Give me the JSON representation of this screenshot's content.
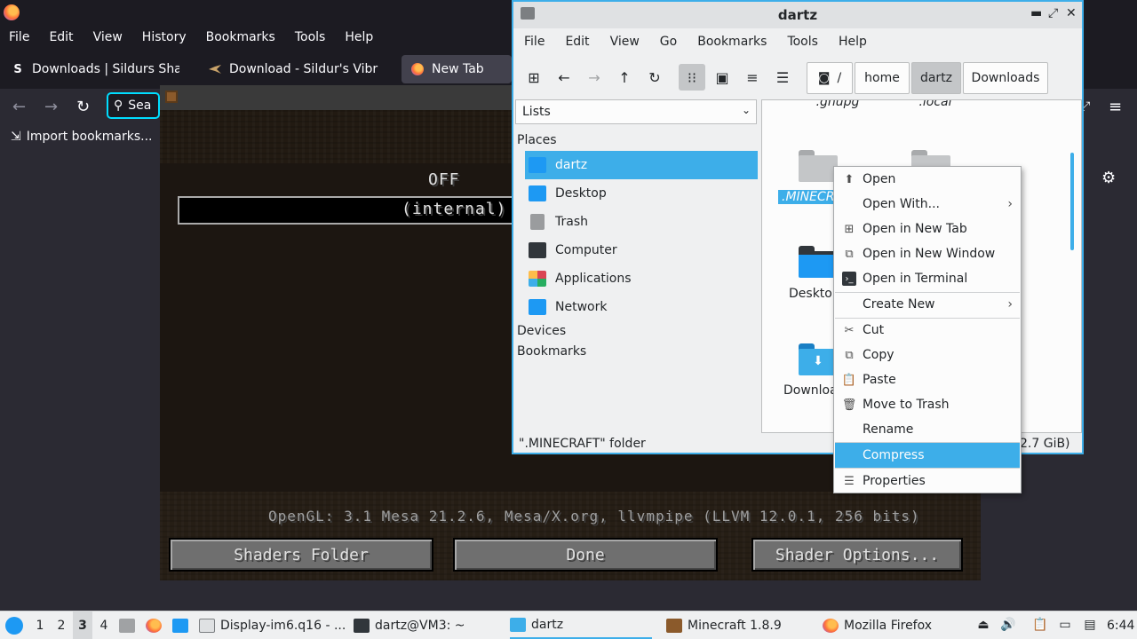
{
  "firefox": {
    "menu": [
      "File",
      "Edit",
      "View",
      "History",
      "Bookmarks",
      "Tools",
      "Help"
    ],
    "tabs": [
      {
        "label": "Downloads | Sildurs Shad",
        "icon_text": "S"
      },
      {
        "label": "Download - Sildur's Vibra",
        "icon_text": ""
      },
      {
        "label": "New Tab",
        "icon_text": ""
      }
    ],
    "url_placeholder": "Sea",
    "import_bookmarks": "Import bookmarks..."
  },
  "minecraft": {
    "option_value": "OFF",
    "selected_pack": "(internal)",
    "opengl_info": "OpenGL: 3.1 Mesa 21.2.6, Mesa/X.org, llvmpipe (LLVM 12.0.1, 256 bits)",
    "buttons": {
      "shaders_folder": "Shaders Folder",
      "done": "Done",
      "shader_options": "Shader Options..."
    }
  },
  "filemanager": {
    "title": "dartz",
    "menu": [
      "File",
      "Edit",
      "View",
      "Go",
      "Bookmarks",
      "Tools",
      "Help"
    ],
    "breadcrumb": {
      "root": "/",
      "items": [
        "home",
        "dartz",
        "Downloads"
      ]
    },
    "side_mode": "Lists",
    "places_header": "Places",
    "places": [
      "dartz",
      "Desktop",
      "Trash",
      "Computer",
      "Applications",
      "Network"
    ],
    "devices_header": "Devices",
    "bookmarks_header": "Bookmarks",
    "files": {
      "gnupg": ".gnupg",
      "local": ".local",
      "minecraft": ".MINECRA",
      "desktop": "Deskto",
      "downloads": "Downloa"
    },
    "status_left": "\".MINECRAFT\" folder",
    "status_right": "2.7 GiB)"
  },
  "context_menu": {
    "open": "Open",
    "open_with": "Open With...",
    "open_new_tab": "Open in New Tab",
    "open_new_window": "Open in New Window",
    "open_terminal": "Open in Terminal",
    "create_new": "Create New",
    "cut": "Cut",
    "copy": "Copy",
    "paste": "Paste",
    "move_trash": "Move to Trash",
    "rename": "Rename",
    "compress": "Compress",
    "properties": "Properties"
  },
  "taskbar": {
    "workspaces": [
      "1",
      "2",
      "3",
      "4"
    ],
    "current_workspace": "3",
    "tasks": {
      "display": "Display-im6.q16 - ...",
      "terminal": "dartz@VM3: ~",
      "files": "dartz",
      "minecraft": "Minecraft 1.8.9",
      "firefox": "Mozilla Firefox"
    },
    "clock": "6:44"
  },
  "colors": {
    "accent": "#3daee9",
    "panel": "#eff0f1",
    "firefox_dark": "#1c1b22"
  }
}
